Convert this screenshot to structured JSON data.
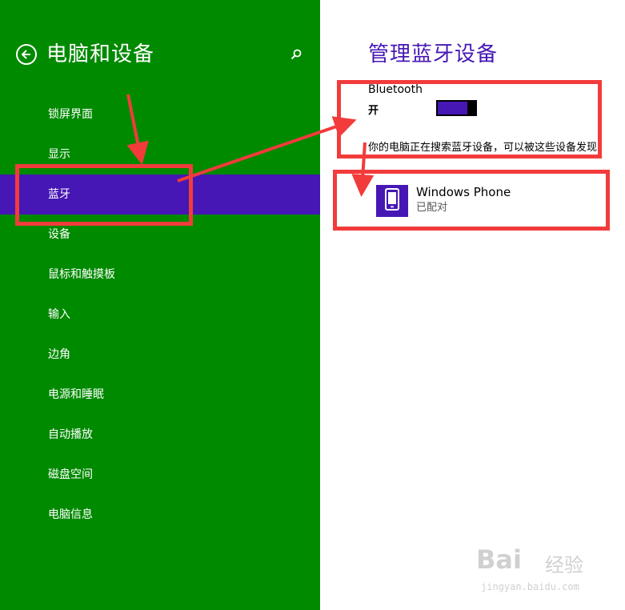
{
  "left_pane": {
    "title": "电脑和设备",
    "nav_items": [
      {
        "label": "锁屏界面",
        "selected": false
      },
      {
        "label": "显示",
        "selected": false
      },
      {
        "label": "蓝牙",
        "selected": true
      },
      {
        "label": "设备",
        "selected": false
      },
      {
        "label": "鼠标和触摸板",
        "selected": false
      },
      {
        "label": "输入",
        "selected": false
      },
      {
        "label": "边角",
        "selected": false
      },
      {
        "label": "电源和睡眠",
        "selected": false
      },
      {
        "label": "自动播放",
        "selected": false
      },
      {
        "label": "磁盘空间",
        "selected": false
      },
      {
        "label": "电脑信息",
        "selected": false
      }
    ]
  },
  "right_pane": {
    "title": "管理蓝牙设备",
    "bluetooth": {
      "label": "Bluetooth",
      "state_label": "开",
      "on": true
    },
    "status_text": "你的电脑正在搜索蓝牙设备，可以被这些设备发现",
    "devices": [
      {
        "name": "Windows Phone",
        "status": "已配对",
        "icon": "phone-icon"
      }
    ]
  },
  "watermark": {
    "logo_text": "Bai",
    "logo_cn": "经验",
    "url": "jingyan.baidu.com"
  },
  "colors": {
    "left_background": "#008a00",
    "accent": "#4617b4",
    "annotation": "#f23b3b"
  },
  "icons": {
    "back": "back-arrow-icon",
    "search": "search-icon",
    "device": "phone-icon"
  }
}
